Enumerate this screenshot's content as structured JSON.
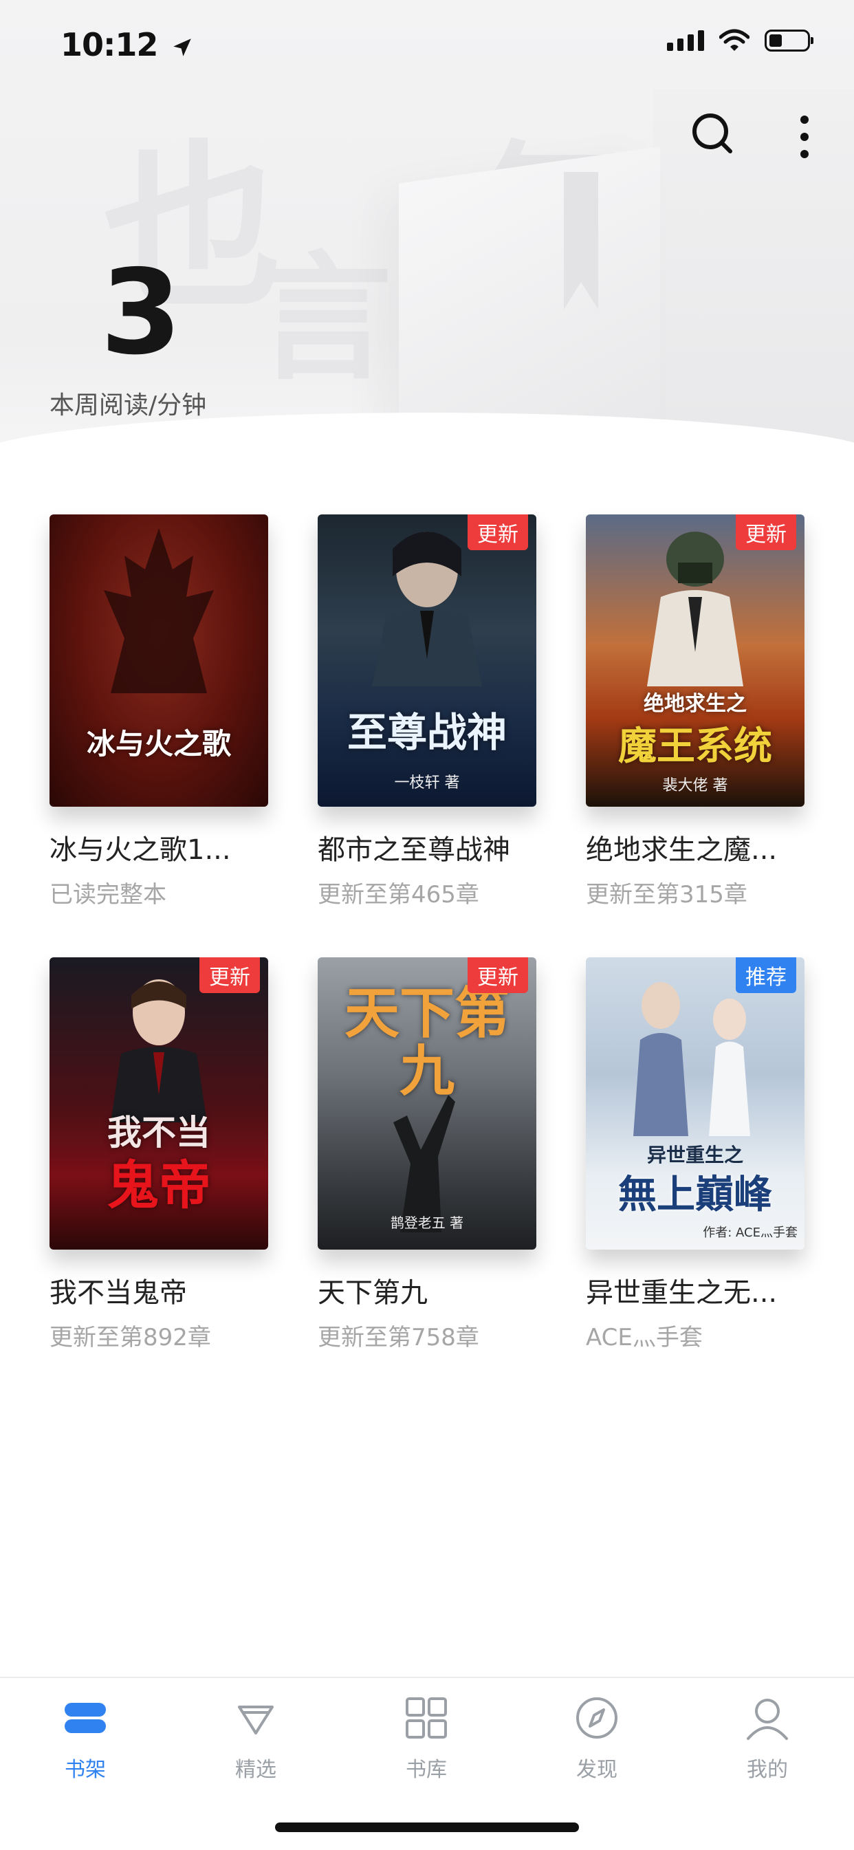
{
  "status": {
    "time": "10:12"
  },
  "header": {
    "stat_value": "3",
    "stat_label": "本周阅读/分钟"
  },
  "books": [
    {
      "title": "冰与火之歌1...",
      "subtitle": "已读完整本",
      "badge": "",
      "badge_color": "",
      "cover_title": "冰与火之歌",
      "cover_author": ""
    },
    {
      "title": "都市之至尊战神",
      "subtitle": "更新至第465章",
      "badge": "更新",
      "badge_color": "#ee3b3b",
      "cover_title": "至尊战神",
      "cover_author": "一枝轩 著"
    },
    {
      "title": "绝地求生之魔...",
      "subtitle": "更新至第315章",
      "badge": "更新",
      "badge_color": "#ee3b3b",
      "cover_title": "魔王系统",
      "cover_author": "裴大佬 著"
    },
    {
      "title": "我不当鬼帝",
      "subtitle": "更新至第892章",
      "badge": "更新",
      "badge_color": "#ee3b3b",
      "cover_title": "我不当鬼帝",
      "cover_author": ""
    },
    {
      "title": "天下第九",
      "subtitle": "更新至第758章",
      "badge": "更新",
      "badge_color": "#ee3b3b",
      "cover_title": "天下第九",
      "cover_author": "鹊登老五 著"
    },
    {
      "title": "异世重生之无...",
      "subtitle": "ACE灬手套",
      "badge": "推荐",
      "badge_color": "#2f82f0",
      "cover_title": "無上巔峰",
      "cover_author": "作者: ACE灬手套"
    }
  ],
  "tabs": [
    {
      "label": "书架",
      "icon": "bookshelf-icon"
    },
    {
      "label": "精选",
      "icon": "diamond-icon"
    },
    {
      "label": "书库",
      "icon": "grid-icon"
    },
    {
      "label": "发现",
      "icon": "compass-icon"
    },
    {
      "label": "我的",
      "icon": "profile-icon"
    }
  ],
  "colors": {
    "accent": "#2f82f0",
    "update_badge": "#ee3b3b"
  }
}
